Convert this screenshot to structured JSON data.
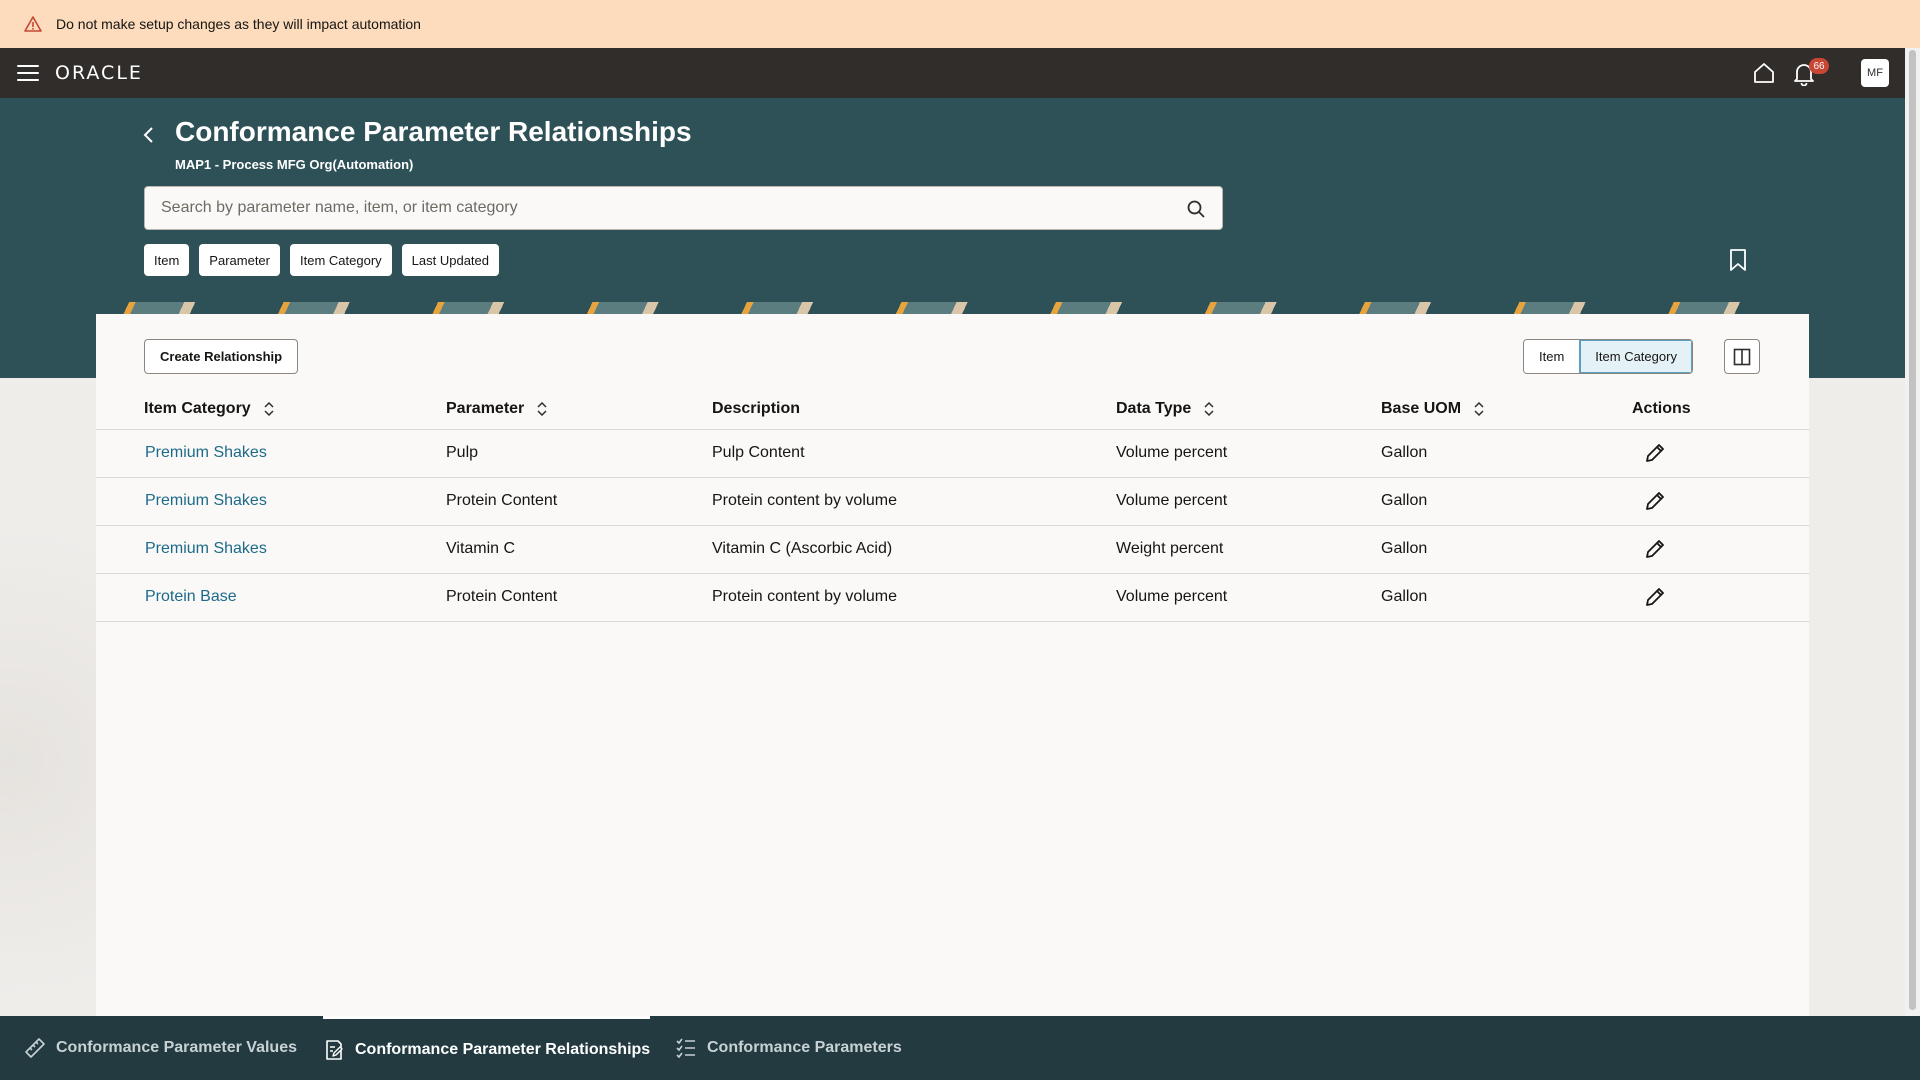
{
  "banner": {
    "text": "Do not make setup changes as they will impact automation"
  },
  "topbar": {
    "logo": "ORACLE",
    "notifications_count": "66",
    "avatar_initials": "MF"
  },
  "header": {
    "title": "Conformance Parameter Relationships",
    "subtitle": "MAP1 - Process MFG Org(Automation)",
    "search_placeholder": "Search by parameter name, item, or item category",
    "filters": [
      "Item",
      "Parameter",
      "Item Category",
      "Last Updated"
    ]
  },
  "toolbar": {
    "create_label": "Create Relationship",
    "view_options": [
      "Item",
      "Item Category"
    ],
    "selected_view": "Item Category"
  },
  "table": {
    "columns": [
      "Item Category",
      "Parameter",
      "Description",
      "Data Type",
      "Base UOM",
      "Actions"
    ],
    "rows": [
      [
        "Premium Shakes",
        "Pulp",
        "Pulp Content",
        "Volume percent",
        "Gallon"
      ],
      [
        "Premium Shakes",
        "Protein Content",
        "Protein content by volume",
        "Volume percent",
        "Gallon"
      ],
      [
        "Premium Shakes",
        "Vitamin C",
        "Vitamin C (Ascorbic Acid)",
        "Weight percent",
        "Gallon"
      ],
      [
        "Protein Base",
        "Protein Content",
        "Protein content by volume",
        "Volume percent",
        "Gallon"
      ]
    ]
  },
  "bottom_nav": {
    "items": [
      "Conformance Parameter Values",
      "Conformance Parameter Relationships",
      "Conformance Parameters"
    ],
    "active": "Conformance Parameter Relationships"
  },
  "colors": {
    "header_band": "#2e5157",
    "topbar": "#312d2a",
    "banner": "#fcdcbc",
    "link": "#1b6a89",
    "bottom_nav": "#223a40"
  }
}
